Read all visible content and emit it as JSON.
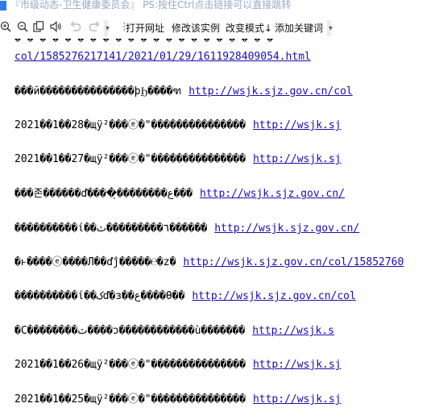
{
  "window": {
    "title": "『市级动态-卫生健康委员会』 PS:按住Ctrl点击链接可以直接跳转"
  },
  "toolbar": {
    "buttons": [
      "打开网址",
      "修改该实例",
      "改变模式↓",
      "添加关键词"
    ],
    "icons": [
      "zoom-in-icon",
      "zoom-out-icon",
      "copy-icon",
      "speaker-icon",
      "undo-icon",
      "redo-icon"
    ]
  },
  "content": {
    "top_fragment": "� � � � � � � � � � � � � � � � � � � � �",
    "top_link": "col/1585276217141/2021/01/29/1611928409054.html",
    "lines": [
      {
        "text": "���й���������������þϦ����ฑ",
        "link": "http://wsjk.sjz.gov.cn/col"
      },
      {
        "text": "2021��1��28�щÿ²���ⓔ�\"���������������",
        "link": "http://wsjk.sj"
      },
      {
        "text": "2021��1��27�щÿ²���ⓔ�\"���������������",
        "link": "http://wsjk.sj"
      },
      {
        "text": "���존������ď����ͅ��������ع���",
        "link": "http://wsjk.sjz.gov.cn/"
      },
      {
        "text": "����������ί��٦���������ٽ������",
        "link": "http://wsjk.sjz.gov.cn/"
      },
      {
        "text": "�ͱ����ⓔ����Л��ďĵ�����℮�z�",
        "link": "http://wsjk.sjz.gov.cn/col/15852760"
      },
      {
        "text": "����������ί��کď�з��ع����Ɵ��",
        "link": "http://wsjk.sjz.gov.cn/col"
      },
      {
        "text": "�С��������ٽ����ɔ������������ù�������",
        "link": "http://wsjk.s"
      },
      {
        "text": "2021��1��26�щÿ²���ⓔ�\"���������������",
        "link": "http://wsjk.sj"
      },
      {
        "text": "2021��1��25�щÿ²���ⓔ�\"���������������",
        "link": "http://wsjk.sj"
      }
    ]
  }
}
